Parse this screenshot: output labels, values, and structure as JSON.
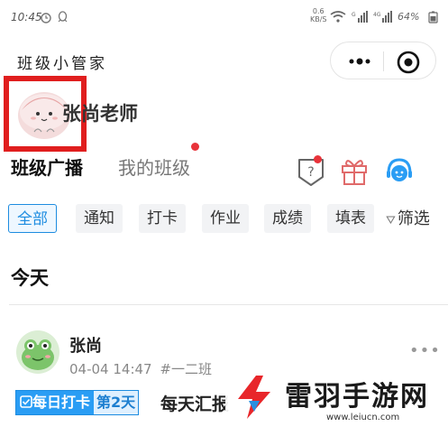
{
  "status_bar": {
    "time": "10:45",
    "net_speed_value": "0.6",
    "net_speed_unit": "KB/S",
    "battery": "64%"
  },
  "header": {
    "app_title": "班级小管家",
    "capsule_more_icon": "more-dots-icon",
    "capsule_close_icon": "target-close-icon"
  },
  "profile": {
    "teacher_name": "张尚老师"
  },
  "tabs": {
    "broadcast": "班级广播",
    "my_class": "我的班级"
  },
  "tools": {
    "help_label": "?",
    "icons": [
      "help-shield-icon",
      "gift-icon",
      "customer-service-icon"
    ]
  },
  "filters": {
    "chips": [
      "全部",
      "通知",
      "打卡",
      "作业",
      "成绩",
      "填表"
    ],
    "active_index": 0,
    "filter_label": "筛选"
  },
  "feed": {
    "section_title": "今天",
    "post": {
      "author": "张尚",
      "date": "04-04 14:47",
      "class": "#一二班",
      "tag": "每日打卡",
      "day_tag": "第2天",
      "title": "每天汇报"
    }
  },
  "watermark": {
    "name": "雷羽手游网",
    "url": "www.leiucn.com"
  },
  "colors": {
    "accent_blue": "#1d8ce0",
    "highlight_red": "#e01e1e",
    "badge_red": "#e8333a"
  }
}
